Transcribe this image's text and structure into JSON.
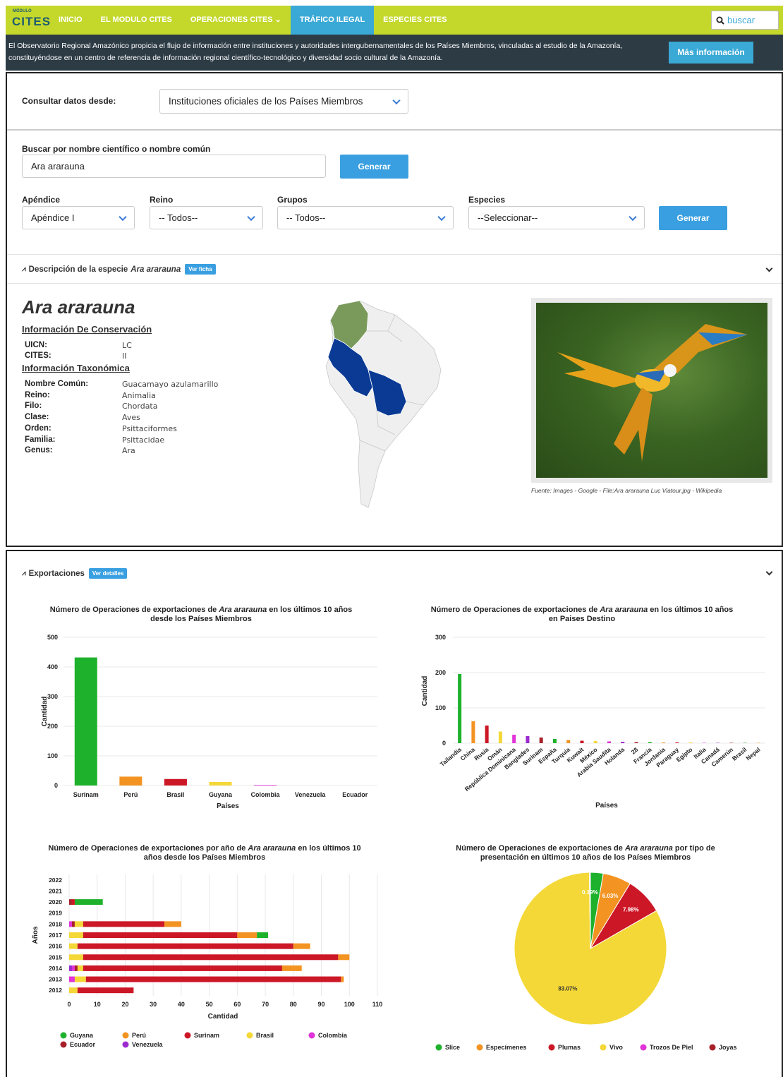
{
  "nav": {
    "logo_small": "MÓDULO",
    "logo_big": "CITES",
    "items": [
      "INICIO",
      "EL MODULO CITES",
      "OPERACIONES CITES ⌄",
      "TRÁFICO ILEGAL",
      "ESPECIES CITES"
    ],
    "active_index": 3,
    "search_placeholder": "buscar"
  },
  "infobar": {
    "text": "El Observatorio Regional Amazónico propicia el flujo de información entre instituciones y autoridades intergubernamentales de los Países Miembros, vinculadas al estudio de la Amazonía, constituyéndose en un centro de referencia de información regional científico-tecnológico y diversidad socio cultural de la Amazonía.",
    "button": "Más información"
  },
  "query": {
    "consult_label": "Consultar datos desde:",
    "consult_value": "Instituciones oficiales de los Países Miembros",
    "search_label": "Buscar por nombre científico o nombre común",
    "search_value": "Ara ararauna",
    "generate": "Generar",
    "filters": {
      "apendice_label": "Apéndice",
      "apendice_value": "Apéndice I",
      "reino_label": "Reino",
      "reino_value": "-- Todos--",
      "grupos_label": "Grupos",
      "grupos_value": "-- Todos--",
      "especies_label": "Especies",
      "especies_value": "--Seleccionar--"
    }
  },
  "species": {
    "section_prefix": "Descripción de la especie",
    "name": "Ara ararauna",
    "ver_ficha": "Ver ficha",
    "conservation_title": "Información De Conservación",
    "conservation": [
      {
        "k": "UICN:",
        "v": "LC"
      },
      {
        "k": "CITES:",
        "v": "II"
      }
    ],
    "taxonomy_title": "Información Taxonómica",
    "taxonomy": [
      {
        "k": "Nombre Común:",
        "v": "Guacamayo azulamarillo"
      },
      {
        "k": "Reino:",
        "v": "Animalia"
      },
      {
        "k": "Filo:",
        "v": "Chordata"
      },
      {
        "k": "Clase:",
        "v": "Aves"
      },
      {
        "k": "Orden:",
        "v": "Psittaciformes"
      },
      {
        "k": "Familia:",
        "v": "Psittacidae"
      },
      {
        "k": "Genus:",
        "v": "Ara"
      }
    ],
    "photo_caption": "Fuente: Images - Google - File:Ara ararauna Luc Viatour.jpg - Wikipedia",
    "map_colors": {
      "base": "#efefef",
      "green": "#7a9a5c",
      "blue": "#0a3a94"
    }
  },
  "exports": {
    "section": "Exportaciones",
    "ver_detalles": "Ver detalles"
  },
  "chart_data": [
    {
      "type": "bar",
      "title_pre": "Número de Operaciones de exportaciones de ",
      "title_species": "Ara ararauna",
      "title_post": " en los últimos 10 años desde los Países Miembros",
      "xlabel": "Países",
      "ylabel": "Cantidad",
      "ylim": [
        0,
        500
      ],
      "yticks": [
        0,
        100,
        200,
        300,
        400,
        500
      ],
      "categories": [
        "Surinam",
        "Perú",
        "Brasil",
        "Guyana",
        "Colombia",
        "Venezuela",
        "Ecuador"
      ],
      "values": [
        432,
        30,
        22,
        12,
        2,
        0,
        0
      ],
      "colors": [
        "#1eb12c",
        "#f39322",
        "#cc1727",
        "#f4d837",
        "#e033d8",
        "#9b2bd0",
        "#a8212a"
      ]
    },
    {
      "type": "bar",
      "title_pre": "Número de Operaciones de exportaciones de ",
      "title_species": "Ara ararauna",
      "title_post": " en los últimos 10 años en Paises Destino",
      "xlabel": "Países",
      "ylabel": "Cantidad",
      "ylim": [
        0,
        300
      ],
      "yticks": [
        0,
        100,
        200,
        300
      ],
      "categories": [
        "Tailandia",
        "China",
        "Rusia",
        "Omán",
        "República Dominicana",
        "Banglades",
        "Surinam",
        "España",
        "Turquia",
        "Kuwait",
        "México",
        "Arabia Saudita",
        "Holanda",
        "28",
        "Francia",
        "Jordania",
        "Paraguay",
        "Egipto",
        "Italia",
        "Canadá",
        "Camerún",
        "Brasil",
        "Nepal"
      ],
      "values": [
        196,
        62,
        50,
        33,
        24,
        20,
        16,
        12,
        9,
        7,
        6,
        5,
        4,
        3,
        3,
        2,
        2,
        2,
        1,
        1,
        1,
        1,
        1
      ],
      "colors": [
        "#1eb12c",
        "#f39322",
        "#cc1727",
        "#f4d837",
        "#e033d8",
        "#9b2bd0",
        "#a8212a",
        "#1eb12c",
        "#f39322",
        "#cc1727",
        "#f4d837",
        "#e033d8",
        "#9b2bd0",
        "#a8212a",
        "#1eb12c",
        "#f39322",
        "#cc1727",
        "#f4d837",
        "#e033d8",
        "#9b2bd0",
        "#a8212a",
        "#1eb12c",
        "#f39322"
      ]
    },
    {
      "type": "bar",
      "orientation": "horizontal-stacked",
      "title_pre": "Número de Operaciones de exportaciones por año de ",
      "title_species": "Ara ararauna",
      "title_post": " en los últimos 10 años desde los Países Miembros",
      "xlabel": "Cantidad",
      "ylabel": "Años",
      "xlim": [
        0,
        110
      ],
      "xticks": [
        0,
        10,
        20,
        30,
        40,
        50,
        60,
        70,
        80,
        90,
        100,
        110
      ],
      "categories": [
        "2022",
        "2021",
        "2020",
        "2019",
        "2018",
        "2017",
        "2016",
        "2015",
        "2014",
        "2013",
        "2012"
      ],
      "series": [
        {
          "name": "Venezuela",
          "color": "#9b2bd0",
          "values": [
            0,
            0,
            0,
            0,
            0,
            0,
            0,
            0,
            1,
            0,
            0
          ]
        },
        {
          "name": "Colombia",
          "color": "#e033d8",
          "values": [
            0,
            0,
            0,
            0,
            1,
            0,
            0,
            0,
            1,
            2,
            0
          ]
        },
        {
          "name": "Ecuador",
          "color": "#a8212a",
          "values": [
            0,
            0,
            1,
            0,
            1,
            0,
            0,
            0,
            1,
            0,
            0
          ]
        },
        {
          "name": "Brasil",
          "color": "#f4d837",
          "values": [
            0,
            0,
            0,
            0,
            3,
            5,
            3,
            5,
            2,
            4,
            3
          ]
        },
        {
          "name": "Surinam",
          "color": "#cc1727",
          "values": [
            0,
            0,
            1,
            0,
            29,
            55,
            77,
            91,
            71,
            91,
            20
          ]
        },
        {
          "name": "Perú",
          "color": "#f39322",
          "values": [
            0,
            0,
            0,
            0,
            6,
            7,
            6,
            4,
            7,
            1,
            0
          ]
        },
        {
          "name": "Guyana",
          "color": "#1eb12c",
          "values": [
            0,
            0,
            10,
            0,
            0,
            4,
            0,
            0,
            0,
            0,
            0
          ]
        }
      ],
      "legend": [
        "Guyana",
        "Perú",
        "Surinam",
        "Brasil",
        "Colombia",
        "Ecuador",
        "Venezuela"
      ]
    },
    {
      "type": "pie",
      "title_pre": "Número de Operaciones de exportaciones de ",
      "title_species": "Ara ararauna",
      "title_post": " por tipo de presentación en últimos 10 años de los Países Miembros",
      "slices": [
        {
          "name": "Slice",
          "value": 2.7,
          "color": "#1eb12c",
          "label": ""
        },
        {
          "name": "Especímenes",
          "value": 6.03,
          "color": "#f39322",
          "label": "6.03%"
        },
        {
          "name": "Plumas",
          "value": 7.98,
          "color": "#cc1727",
          "label": "7.98%"
        },
        {
          "name": "Vivo",
          "value": 83.07,
          "color": "#f4d837",
          "label": "83.07%"
        },
        {
          "name": "Trozos De Piel",
          "value": 0.19,
          "color": "#e033d8",
          "label": "0.19%"
        },
        {
          "name": "Joyas",
          "value": 0.03,
          "color": "#a8212a",
          "label": ""
        }
      ]
    }
  ]
}
